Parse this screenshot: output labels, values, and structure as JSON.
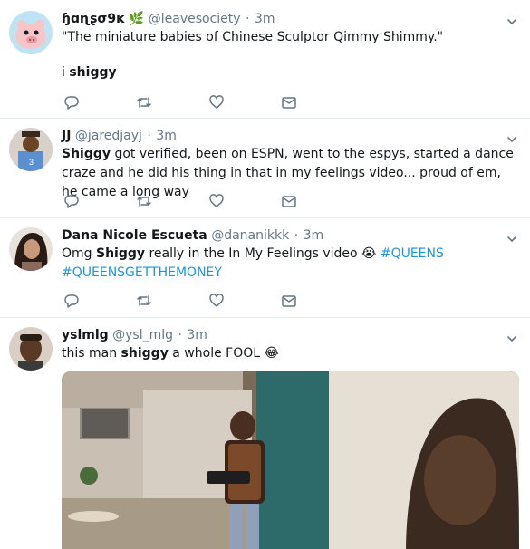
{
  "tweets": [
    {
      "display_name": "ɧɑɳʂσ9ĸ",
      "name_emoji": "🌿",
      "handle": "@leavesociety",
      "time": "3m",
      "quote_line": "\"The miniature babies of Chinese Sculptor Qimmy Shimmy.\"",
      "reply_prefix": "i ",
      "reply_bold": "shiggy"
    },
    {
      "display_name": "JJ",
      "handle": "@jaredjayj",
      "time": "3m",
      "bold_start": "Shiggy",
      "text": " got verified, been on ESPN, went to the espys, started a dance craze and he did his thing in that in my feelings video... proud of em, he came a long way"
    },
    {
      "display_name": "Dana Nicole Escueta",
      "handle": "@dananikkk",
      "time": "3m",
      "text_pre": "Omg ",
      "bold": "Shiggy",
      "text_mid": " really in the In My Feelings video ",
      "emoji": "😭",
      "hashtag1": "#QUEENS",
      "hashtag2": "#QUEENSGETTHEMONEY"
    },
    {
      "display_name": "yslmlg",
      "handle": "@ysl_mlg",
      "time": "3m",
      "text_pre": "this man ",
      "bold": "shiggy",
      "text_post": " a whole FOOL ",
      "emoji": "😂"
    }
  ],
  "separator": "·",
  "icons": [
    "reply-icon",
    "retweet-icon",
    "like-icon",
    "direct-message-icon",
    "chevron-down-icon"
  ],
  "colors": {
    "text": "#14171a",
    "muted": "#657786",
    "link": "#1b95e0",
    "border": "#e6ecf0"
  }
}
